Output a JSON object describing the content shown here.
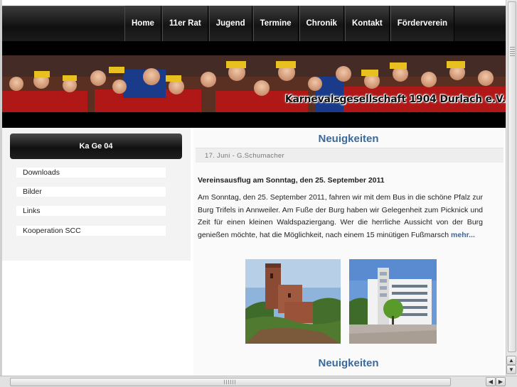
{
  "nav": {
    "items": [
      {
        "label": "Home"
      },
      {
        "label": "11er Rat"
      },
      {
        "label": "Jugend"
      },
      {
        "label": "Termine"
      },
      {
        "label": "Chronik"
      },
      {
        "label": "Kontakt"
      },
      {
        "label": "Förderverein"
      }
    ]
  },
  "banner": {
    "text": "Karnevalsgesellschaft 1904 Durlach e.V."
  },
  "sidebar": {
    "title": "Ka Ge 04",
    "links": [
      {
        "label": "Downloads"
      },
      {
        "label": "Bilder"
      },
      {
        "label": "Links"
      },
      {
        "label": "Kooperation SCC"
      }
    ]
  },
  "main": {
    "heading": "Neuigkeiten",
    "meta": "17. Juni - G.Schumacher",
    "article_title": "Vereinsausflug am Sonntag, den 25. September 2011",
    "article_body": "Am Sonntag, den 25. September 2011, fahren wir mit dem Bus in die schöne Pfalz zur Burg Trifels in Annweiler. Am Fuße der Burg haben wir Gelegenheit zum Picknick und Zeit für einen kleinen Waldspaziergang. Wer die herrliche Aussicht von der Burg genießen möchte, hat die Möglichkeit, nach einem 15 minütigen Fußmarsch",
    "more_label": "mehr...",
    "heading2": "Neuigkeiten"
  },
  "scrollbar": {
    "up_icon": "▲",
    "down_icon": "▼",
    "left_icon": "◀",
    "right_icon": "▶"
  },
  "colors": {
    "accent": "#3a6a9a",
    "nav_bg": "#1a1a1a"
  }
}
